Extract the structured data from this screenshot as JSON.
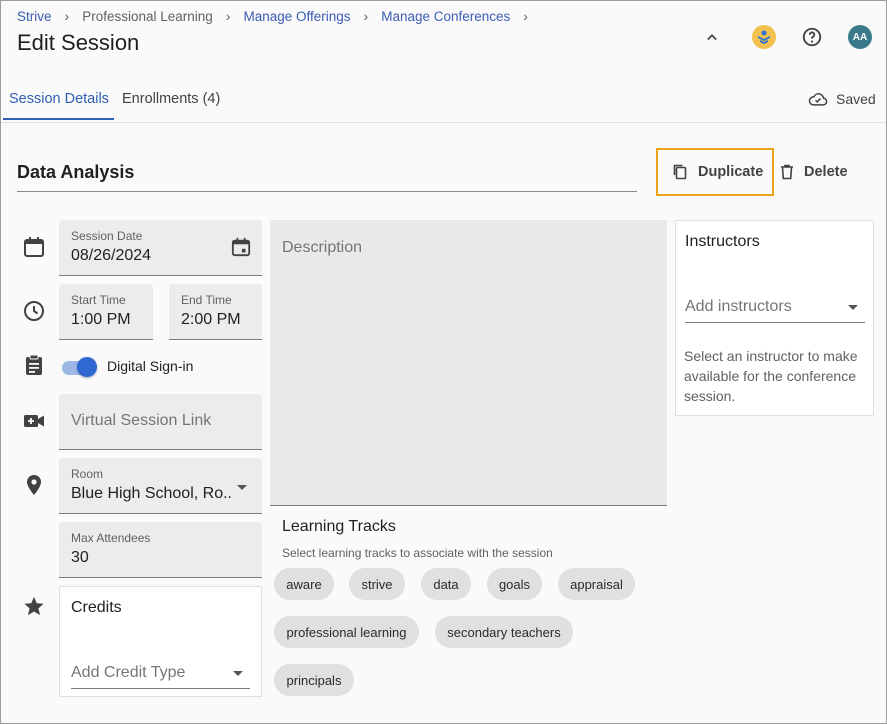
{
  "breadcrumb": [
    {
      "label": "Strive",
      "link": true
    },
    {
      "label": "Professional Learning",
      "link": false
    },
    {
      "label": "Manage Offerings",
      "link": true
    },
    {
      "label": "Manage Conferences",
      "link": true
    }
  ],
  "header": {
    "title": "Edit Session",
    "avatar_initials": "AA",
    "icons": [
      "chevron-up-icon",
      "strive-logo-icon",
      "help-icon"
    ]
  },
  "tabs": [
    {
      "label": "Session Details",
      "active": true
    },
    {
      "label": "Enrollments (4)",
      "active": false
    }
  ],
  "status": {
    "saved_label": "Saved"
  },
  "session": {
    "name": "Data Analysis",
    "duplicate_label": "Duplicate",
    "delete_label": "Delete"
  },
  "fields": {
    "date_label": "Session Date",
    "date_value": "08/26/2024",
    "start_label": "Start Time",
    "start_value": "1:00 PM",
    "end_label": "End Time",
    "end_value": "2:00 PM",
    "digital_signin_label": "Digital Sign-in",
    "digital_signin_on": true,
    "virtual_link_placeholder": "Virtual Session Link",
    "room_label": "Room",
    "room_value": "Blue High School, Ro...",
    "max_label": "Max Attendees",
    "max_value": "30",
    "credits_title": "Credits",
    "credit_type_placeholder": "Add Credit Type",
    "description_placeholder": "Description"
  },
  "learning_tracks": {
    "title": "Learning Tracks",
    "subtitle": "Select learning tracks to associate with the session",
    "chips": [
      "aware",
      "strive",
      "data",
      "goals",
      "appraisal",
      "professional learning",
      "secondary teachers",
      "principals"
    ]
  },
  "instructors": {
    "title": "Instructors",
    "placeholder": "Add instructors",
    "hint": "Select an instructor to make available for the conference session."
  },
  "colors": {
    "accent": "#2f5fb3",
    "highlight": "#e8a317",
    "toggle": "#2f68d1"
  }
}
